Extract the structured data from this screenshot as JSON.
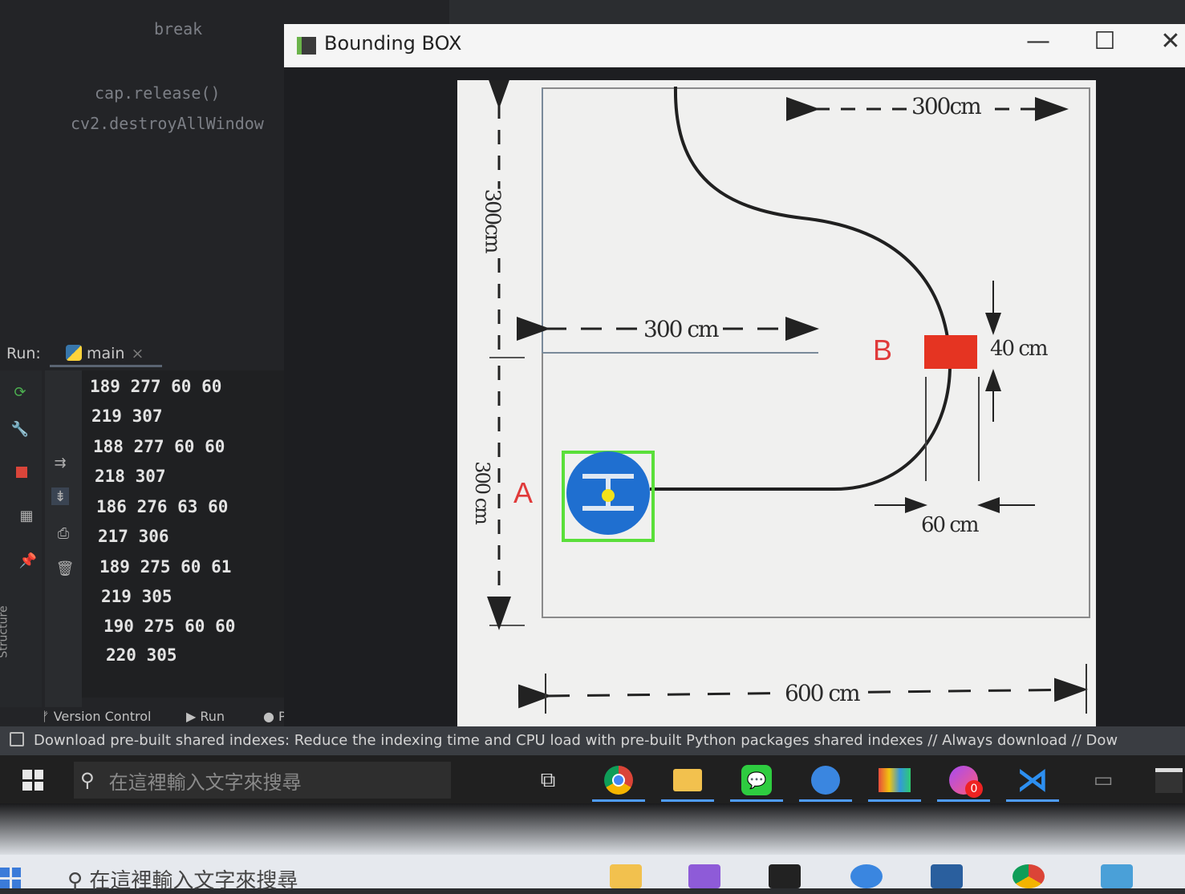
{
  "editor": {
    "code_lines": [
      "break",
      "cap.release()",
      "cv2.destroyAllWindow"
    ]
  },
  "run_panel": {
    "run_label": "Run:",
    "tab_name": "main",
    "close_symbol": "×",
    "output": [
      "189 277 60 60",
      "219 307",
      "188 277 60 60",
      "218 307",
      "186 276 63 60",
      "217 306",
      "189 275 60 61",
      "219 305",
      "190 275 60 60",
      "220 305"
    ],
    "structure_label": "Structure"
  },
  "bottom_tabs": {
    "version_control": "Version Control",
    "run": "Run",
    "python": "Pyth"
  },
  "status_bar": {
    "message": "Download pre-built shared indexes: Reduce the indexing time and CPU load with pre-built Python packages shared indexes // Always download // Dow"
  },
  "cv_window": {
    "title": "Bounding BOX",
    "minimize": "—",
    "maximize": "☐",
    "close": "✕"
  },
  "diagram": {
    "dim_300_top": "300cm",
    "dim_300_left": "300cm",
    "dim_300_mid": "300 cm",
    "dim_300_lower_left": "300 cm",
    "dim_40": "40 cm",
    "dim_60": "60 cm",
    "dim_600": "600 cm",
    "label_a": "A",
    "label_b": "B",
    "colors": {
      "point_a": "#e03a3a",
      "point_b": "#e53422",
      "robot": "#1f6fd0",
      "bbox": "#5adf3a",
      "centroid": "#f3e21a"
    }
  },
  "taskbar": {
    "search_placeholder": "在這裡輸入文字來搜尋",
    "icons": [
      "task-view-icon",
      "chrome-icon",
      "file-explorer-icon",
      "line-icon",
      "maps-icon",
      "photos-icon",
      "messenger-icon",
      "vscode-icon",
      "app-icon",
      "terminal-icon"
    ],
    "badge": "0"
  },
  "outer_taskbar": {
    "search_placeholder": "在這裡輸入文字來搜尋"
  }
}
